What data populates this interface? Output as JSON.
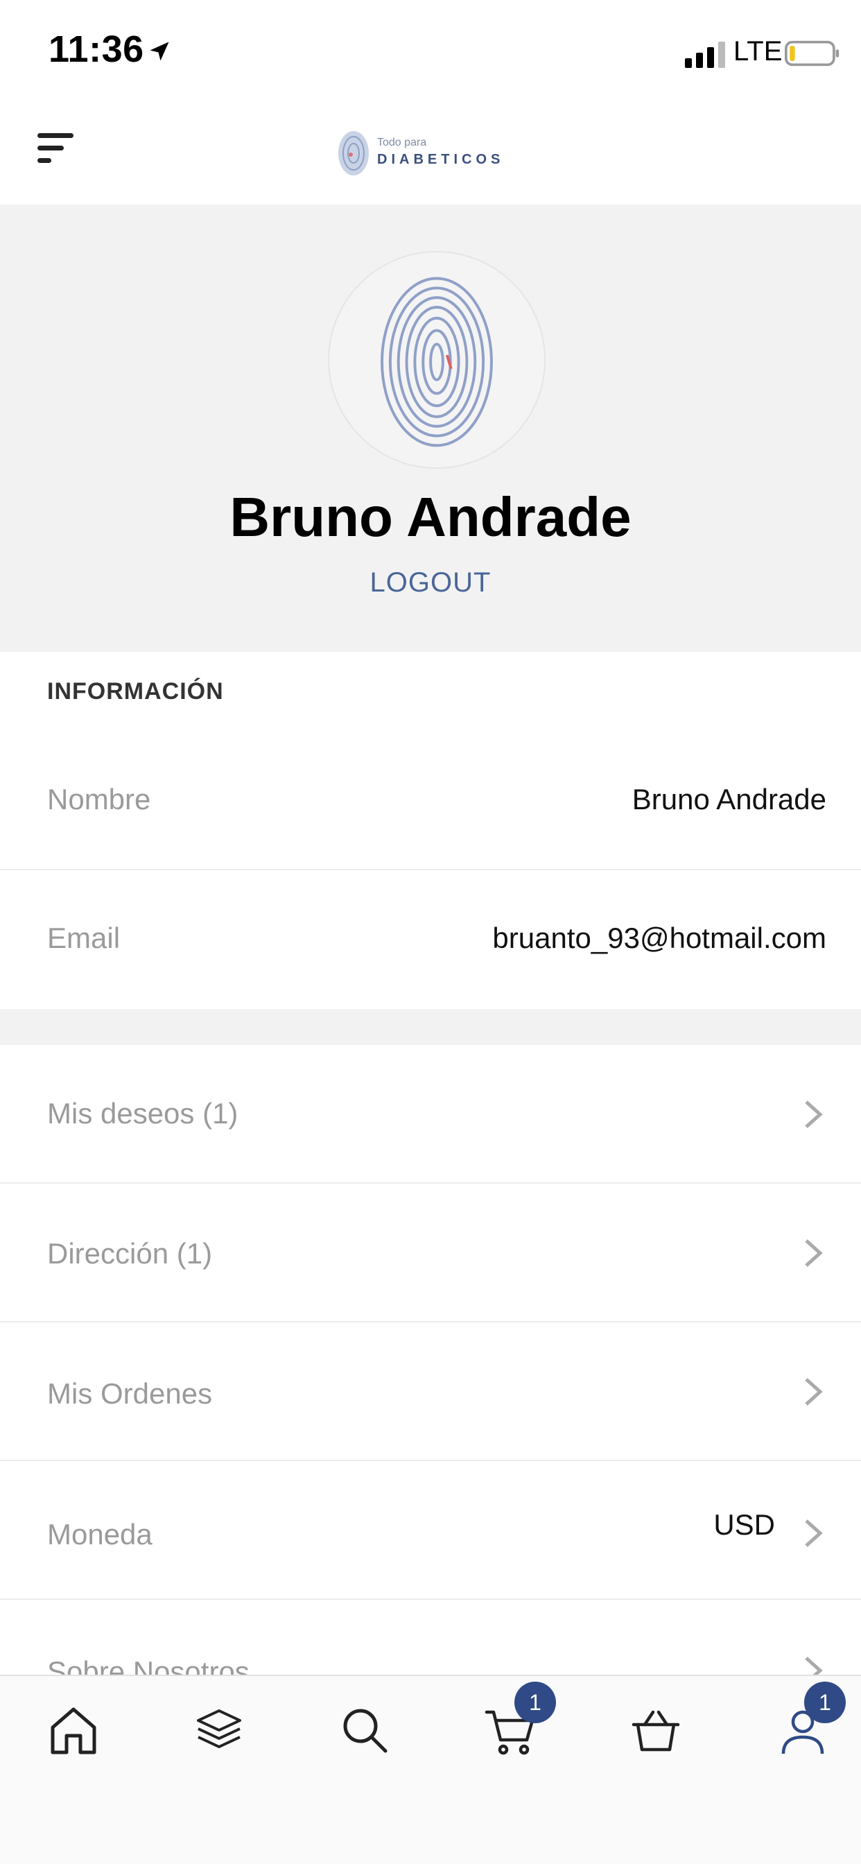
{
  "status_bar": {
    "time": "11:36",
    "network": "LTE"
  },
  "header": {
    "logo_small": "Todo para",
    "logo_big": "DIABETICOS"
  },
  "profile": {
    "name": "Bruno Andrade",
    "logout_label": "LOGOUT"
  },
  "info": {
    "section_title": "INFORMACIÓN",
    "fields": [
      {
        "label": "Nombre",
        "value": "Bruno Andrade"
      },
      {
        "label": "Email",
        "value": "bruanto_93@hotmail.com"
      }
    ]
  },
  "menu": {
    "items": [
      {
        "label": "Mis deseos (1)"
      },
      {
        "label": "Dirección (1)"
      },
      {
        "label": "Mis Ordenes"
      },
      {
        "label": "Moneda",
        "value": "USD"
      },
      {
        "label": "Sobre Nosotros"
      }
    ]
  },
  "tabbar": {
    "cart_badge": "1",
    "account_badge": "1"
  },
  "colors": {
    "accent": "#2f4a86",
    "logout": "#4a6698",
    "section_bg": "#f2f2f2"
  }
}
